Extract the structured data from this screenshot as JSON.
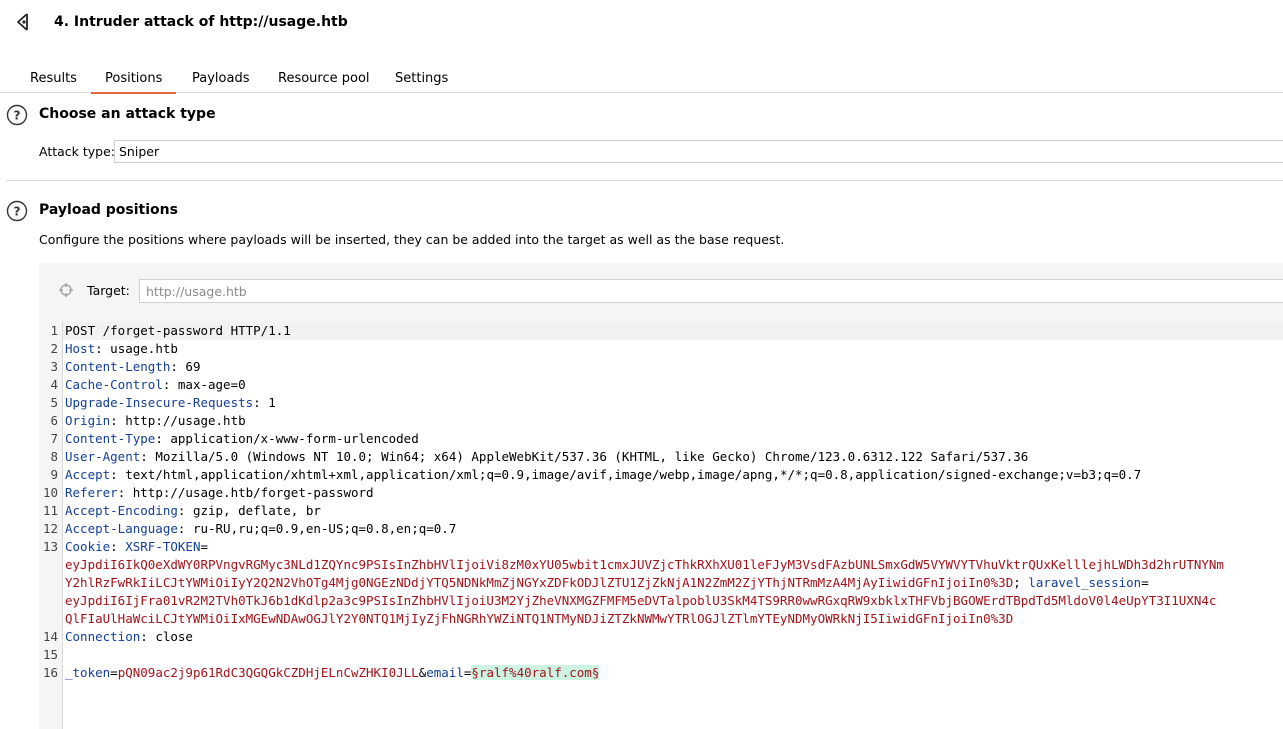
{
  "window": {
    "title": "4. Intruder attack of http://usage.htb"
  },
  "tabs": [
    "Results",
    "Positions",
    "Payloads",
    "Resource pool",
    "Settings"
  ],
  "attack_type": {
    "title": "Choose an attack type",
    "label": "Attack type:",
    "value": "Sniper"
  },
  "payload_positions": {
    "title": "Payload positions",
    "description": "Configure the positions where payloads will be inserted, they can be added into the target as well as the base request.",
    "target_label": "Target:",
    "target_value": "http://usage.htb"
  },
  "request": {
    "request_line": "POST /forget-password HTTP/1.1",
    "headers": [
      {
        "name": "Host",
        "value": "usage.htb"
      },
      {
        "name": "Content-Length",
        "value": "69"
      },
      {
        "name": "Cache-Control",
        "value": "max-age=0"
      },
      {
        "name": "Upgrade-Insecure-Requests",
        "value": "1"
      },
      {
        "name": "Origin",
        "value": "http://usage.htb"
      },
      {
        "name": "Content-Type",
        "value": "application/x-www-form-urlencoded"
      },
      {
        "name": "User-Agent",
        "value": "Mozilla/5.0 (Windows NT 10.0; Win64; x64) AppleWebKit/537.36 (KHTML, like Gecko) Chrome/123.0.6312.122 Safari/537.36"
      },
      {
        "name": "Accept",
        "value": "text/html,application/xhtml+xml,application/xml;q=0.9,image/avif,image/webp,image/apng,*/*;q=0.8,application/signed-exchange;v=b3;q=0.7"
      },
      {
        "name": "Referer",
        "value": "http://usage.htb/forget-password"
      },
      {
        "name": "Accept-Encoding",
        "value": "gzip, deflate, br"
      },
      {
        "name": "Accept-Language",
        "value": "ru-RU,ru;q=0.9,en-US;q=0.8,en;q=0.7"
      }
    ],
    "cookie": {
      "name": "Cookie",
      "xsrf_name": "XSRF-TOKEN",
      "xsrf_value_1": "eyJpdiI6IkQ0eXdWY0RPVngvRGMyc3NLd1ZQYnc9PSIsInZhbHVlIjoiVi8zM0xYU05wbit1cmxJUVZjcThkRXhXU01leFJyM3VsdFAzbUNLSmxGdW5VYWVYTVhuVktrQUxKelllejhLWDh3d2hrUTNYNm",
      "xsrf_value_2": "Y2hlRzFwRkIiLCJtYWMiOiIyY2Q2N2VhOTg4Mjg0NGEzNDdjYTQ5NDNkMmZjNGYxZDFkODJlZTU1ZjZkNjA1N2ZmM2ZjYThjNTRmMzA4MjAyIiwidGFnIjoiIn0%3D",
      "session_name": "laravel_session",
      "session_value_1": "eyJpdiI6IjFra01vR2M2TVh0TkJ6b1dKdlp2a3c9PSIsInZhbHVlIjoiU3M2YjZheVNXMGZFMFM5eDVTalpoblU3SkM4TS9RR0wwRGxqRW9xbklxTHFVbjBGOWErdTBpdTd5MldoV0l4eUpYT3I1UXN4c",
      "session_value_2": "QlFIaUlHaWciLCJtYWMiOiIxMGEwNDAwOGJlY2Y0NTQ1MjIyZjFhNGRhYWZiNTQ1NTMyNDJiZTZkNWMwYTRlOGJlZTlmYTEyNDMyOWRkNjI5IiwidGFnIjoiIn0%3D"
    },
    "connection": {
      "name": "Connection",
      "value": "close"
    },
    "body": {
      "token_name": "_token",
      "token_value": "pQN09ac2j9p61RdC3QGQGkCZDHjELnCwZHKI0JLL",
      "email_name": "email",
      "email_value": "§ralf%40ralf.com§"
    },
    "line_numbers": [
      "1",
      "2",
      "3",
      "4",
      "5",
      "6",
      "7",
      "8",
      "9",
      "10",
      "11",
      "12",
      "13",
      "14",
      "15",
      "16"
    ]
  },
  "colors": {
    "accent": "#e8663d",
    "header_name": "#143f96",
    "value": "#a3131a",
    "payload_marker_bg": "#cdf3e3"
  }
}
